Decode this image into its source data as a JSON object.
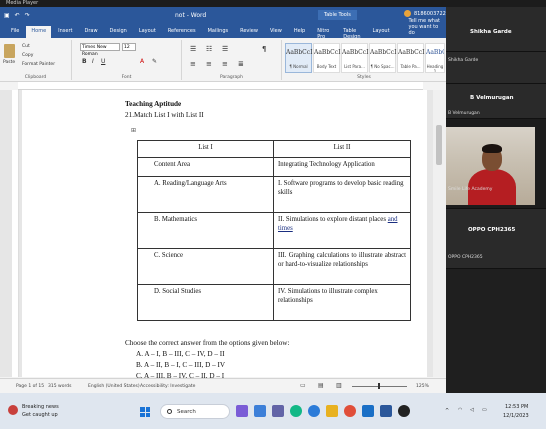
{
  "video_title": "Media Player",
  "word": {
    "title": "not - Word",
    "context_tab": "Table Tools",
    "user_id": "8186003722.68",
    "tabs": [
      "File",
      "Home",
      "Insert",
      "Draw",
      "Design",
      "Layout",
      "References",
      "Mailings",
      "Review",
      "View",
      "Help",
      "Nitro Pro 10",
      "Table Design",
      "Layout"
    ],
    "active_tab": 1,
    "tell_me": "Tell me what you want to do",
    "ribbon": {
      "paste": "Paste",
      "cut": "Cut",
      "copy": "Copy",
      "format_painter": "Format Painter",
      "clipboard": "Clipboard",
      "font_name": "Times New Roman",
      "font_size": "12",
      "font_group": "Font",
      "paragraph_group": "Paragraph",
      "styles_group": "Styles",
      "styles": [
        {
          "sample": "AaBbCcI",
          "name": "¶ Normal"
        },
        {
          "sample": "AaBbCcI",
          "name": "Body Text"
        },
        {
          "sample": "AaBbCcI",
          "name": "List Para..."
        },
        {
          "sample": "AaBbCcI",
          "name": "¶ No Spac..."
        },
        {
          "sample": "AaBbCcI",
          "name": "Table Pa..."
        },
        {
          "sample": "AaBbC",
          "name": "Heading 1"
        }
      ]
    },
    "doc": {
      "heading": "Teaching Aptitude",
      "question": "21.Match List I with List II",
      "table_headers": [
        "List I",
        "List II"
      ],
      "rows": [
        [
          "Content Area",
          "Integrating Technology Application"
        ],
        [
          "A. Reading/Language Arts",
          "I. Software programs to develop basic reading skills"
        ],
        [
          "B. Mathematics",
          "II. Simulations to explore distant places and times"
        ],
        [
          "C. Science",
          "III. Graphing calculations to illustrate abstract or hard-to-visualize relationships"
        ],
        [
          "D. Social Studies",
          "IV. Simulations to illustrate complex relationships"
        ]
      ],
      "instruction": "Choose the correct answer from the options given below:",
      "options": [
        "A. A – I, B – III, C – IV, D – II",
        "B. A – II, B – I, C – III, D – IV",
        "C. A – III, B – IV, C – II, D – I"
      ]
    },
    "status": {
      "page": "Page 1 of 15",
      "words": "315 words",
      "language": "English (United States)",
      "accessibility": "Accessibility: Investigate",
      "zoom": "125%"
    }
  },
  "video_panel": {
    "participants": [
      {
        "name": "Shikha Garde",
        "label": "Shikha Garde"
      },
      {
        "name": "B Velmurugan",
        "label": "B Velmurugan"
      },
      {
        "name": "",
        "label": "Smile Life Academy"
      },
      {
        "name": "OPPO CPH2365",
        "label": "OPPO CPH2365"
      }
    ]
  },
  "taskbar": {
    "news_title": "Breaking news",
    "news_sub": "Get caught up",
    "search": "Search",
    "time": "12:53 PM",
    "date": "12/1/2023"
  }
}
